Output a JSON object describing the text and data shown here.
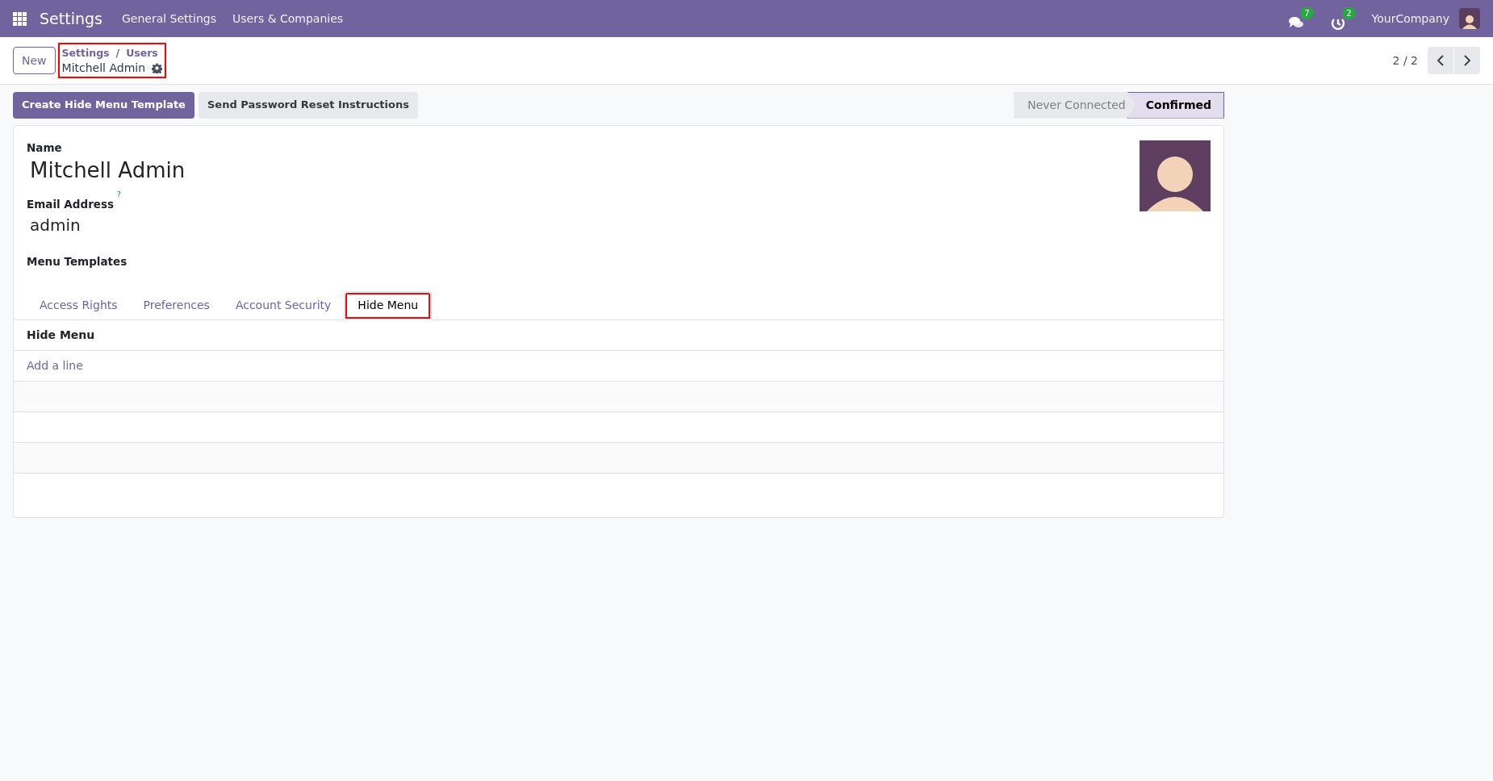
{
  "navbar": {
    "app": "Settings",
    "menus": [
      "General Settings",
      "Users & Companies"
    ],
    "messages_badge": "7",
    "activities_badge": "2",
    "company": "YourCompany"
  },
  "control_panel": {
    "new_button": "New",
    "breadcrumb": [
      "Settings",
      "Users"
    ],
    "breadcrumb_separator": "/",
    "record": "Mitchell Admin",
    "annotated": true,
    "pager": "2 / 2"
  },
  "header_buttons": [
    {
      "label": "Create Hide Menu Template",
      "kind": "primary"
    },
    {
      "label": "Send Password Reset Instructions",
      "kind": "secondary"
    }
  ],
  "status_stages": [
    {
      "label": "Never Connected",
      "selected": false
    },
    {
      "label": "Confirmed",
      "selected": true
    }
  ],
  "form": {
    "name_label": "Name",
    "name": "Mitchell Admin",
    "email_label": "Email Address",
    "email_help": "?",
    "email": "admin",
    "menu_templates_label": "Menu Templates"
  },
  "tabs": [
    {
      "label": "Access Rights",
      "selected": false,
      "annotated": false
    },
    {
      "label": "Preferences",
      "selected": false,
      "annotated": false
    },
    {
      "label": "Account Security",
      "selected": false,
      "annotated": false
    },
    {
      "label": "Hide Menu",
      "selected": true,
      "annotated": true
    }
  ],
  "table": {
    "columns": [
      "Hide Menu"
    ],
    "add_line": "Add a line"
  }
}
